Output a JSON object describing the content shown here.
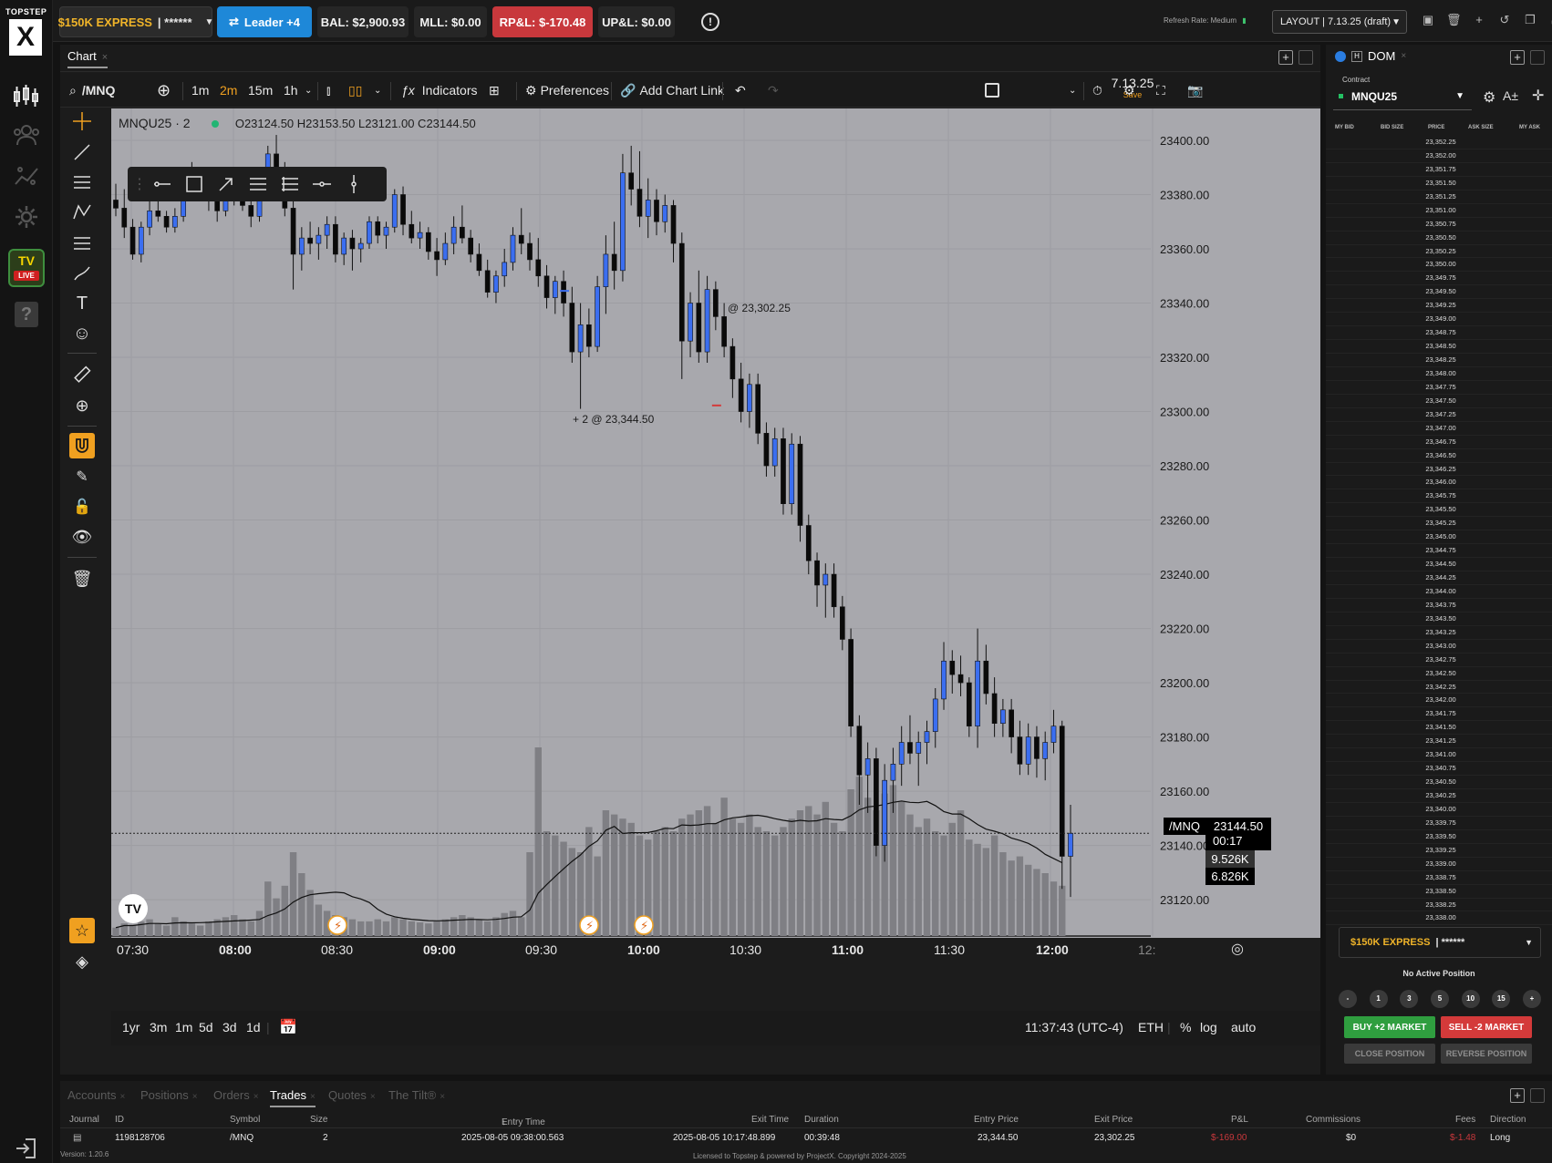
{
  "brand": {
    "line1": "TOPSTEP",
    "line2": "X"
  },
  "rail": {
    "tv_label": "TV",
    "live_label": "LIVE"
  },
  "header": {
    "account_name": "$150K EXPRESS",
    "account_mask": "| ******",
    "leader_label": "Leader +4",
    "bal": "BAL: $2,900.93",
    "mll": "MLL: $0.00",
    "rpl": "RP&L: $-170.48",
    "upl": "UP&L: $0.00",
    "refresh_rate": "Refresh Rate: Medium",
    "layout": "LAYOUT | 7.13.25 (draft)"
  },
  "chart_panel": {
    "tab": "Chart"
  },
  "toolbar": {
    "symbol": "/MNQ",
    "timeframes": [
      "1m",
      "2m",
      "15m",
      "1h"
    ],
    "active_timeframe": "2m",
    "indicators": "Indicators",
    "preferences": "Preferences",
    "add_chart_link": "Add Chart Link",
    "layout_name": "7.13.25",
    "layout_save": "Save"
  },
  "legend": {
    "symbol": "MNQU25 · 2",
    "ohlc": "O23124.50 H23153.50 L23121.00 C23144.50"
  },
  "annotations": {
    "fill_sell": "@ 23,302.25",
    "fill_buy": "+ 2 @ 23,344.50"
  },
  "price_labels": {
    "symbol_tag": "/MNQ",
    "last_price": "23144.50",
    "countdown": "00:17",
    "vol1": "9.526K",
    "vol2": "6.826K"
  },
  "bottom_ranges": [
    "1yr",
    "3m",
    "1m",
    "5d",
    "3d",
    "1d"
  ],
  "status": {
    "clock": "11:37:43 (UTC-4)",
    "session": "ETH",
    "pct": "%",
    "log": "log",
    "auto": "auto"
  },
  "chart_data": {
    "type": "candlestick",
    "symbol": "MNQU25",
    "y_ticks": [
      "23400.00",
      "23380.00",
      "23360.00",
      "23340.00",
      "23320.00",
      "23300.00",
      "23280.00",
      "23260.00",
      "23240.00",
      "23220.00",
      "23200.00",
      "23180.00",
      "23160.00",
      "23140.00",
      "23120.00"
    ],
    "x_ticks": [
      "07:30",
      "08:00",
      "08:30",
      "09:00",
      "09:30",
      "10:00",
      "10:30",
      "11:00",
      "11:30",
      "12:00",
      "12:"
    ],
    "ylim": [
      23116,
      23400
    ],
    "last_price": 23144.5,
    "up_color": "#3b6ef0",
    "down_color": "#0a0a0a",
    "candles": [
      [
        23378,
        23384,
        23372,
        23375
      ],
      [
        23375,
        23382,
        23364,
        23368
      ],
      [
        23368,
        23371,
        23356,
        23358
      ],
      [
        23358,
        23370,
        23355,
        23368
      ],
      [
        23368,
        23378,
        23365,
        23374
      ],
      [
        23374,
        23380,
        23370,
        23372
      ],
      [
        23372,
        23374,
        23366,
        23368
      ],
      [
        23368,
        23375,
        23366,
        23372
      ],
      [
        23372,
        23386,
        23370,
        23384
      ],
      [
        23384,
        23392,
        23382,
        23388
      ],
      [
        23388,
        23390,
        23378,
        23381
      ],
      [
        23381,
        23384,
        23374,
        23378
      ],
      [
        23378,
        23380,
        23370,
        23374
      ],
      [
        23374,
        23382,
        23372,
        23380
      ],
      [
        23380,
        23386,
        23376,
        23378
      ],
      [
        23378,
        23384,
        23374,
        23376
      ],
      [
        23376,
        23378,
        23368,
        23372
      ],
      [
        23372,
        23385,
        23370,
        23382
      ],
      [
        23382,
        23398,
        23378,
        23395
      ],
      [
        23395,
        23402,
        23385,
        23388
      ],
      [
        23388,
        23392,
        23372,
        23375
      ],
      [
        23375,
        23378,
        23345,
        23358
      ],
      [
        23358,
        23368,
        23352,
        23364
      ],
      [
        23364,
        23370,
        23358,
        23362
      ],
      [
        23362,
        23368,
        23356,
        23365
      ],
      [
        23365,
        23372,
        23360,
        23369
      ],
      [
        23369,
        23372,
        23355,
        23358
      ],
      [
        23358,
        23366,
        23354,
        23364
      ],
      [
        23364,
        23367,
        23352,
        23360
      ],
      [
        23360,
        23364,
        23355,
        23362
      ],
      [
        23362,
        23372,
        23360,
        23370
      ],
      [
        23370,
        23372,
        23362,
        23365
      ],
      [
        23365,
        23370,
        23360,
        23368
      ],
      [
        23368,
        23382,
        23366,
        23380
      ],
      [
        23380,
        23383,
        23365,
        23369
      ],
      [
        23369,
        23374,
        23362,
        23364
      ],
      [
        23364,
        23370,
        23360,
        23366
      ],
      [
        23366,
        23368,
        23356,
        23359
      ],
      [
        23359,
        23364,
        23350,
        23356
      ],
      [
        23356,
        23366,
        23354,
        23362
      ],
      [
        23362,
        23372,
        23358,
        23368
      ],
      [
        23368,
        23376,
        23362,
        23364
      ],
      [
        23364,
        23367,
        23355,
        23358
      ],
      [
        23358,
        23362,
        23350,
        23352
      ],
      [
        23352,
        23356,
        23342,
        23344
      ],
      [
        23344,
        23352,
        23340,
        23350
      ],
      [
        23350,
        23360,
        23346,
        23355
      ],
      [
        23355,
        23368,
        23352,
        23365
      ],
      [
        23365,
        23375,
        23358,
        23362
      ],
      [
        23362,
        23366,
        23352,
        23356
      ],
      [
        23356,
        23364,
        23346,
        23350
      ],
      [
        23350,
        23354,
        23338,
        23342
      ],
      [
        23342,
        23350,
        23336,
        23348
      ],
      [
        23348,
        23352,
        23335,
        23340
      ],
      [
        23340,
        23346,
        23318,
        23322
      ],
      [
        23322,
        23340,
        23301,
        23332
      ],
      [
        23332,
        23338,
        23320,
        23324
      ],
      [
        23324,
        23350,
        23322,
        23346
      ],
      [
        23346,
        23365,
        23336,
        23358
      ],
      [
        23358,
        23370,
        23345,
        23352
      ],
      [
        23352,
        23395,
        23348,
        23388
      ],
      [
        23388,
        23398,
        23376,
        23382
      ],
      [
        23382,
        23396,
        23368,
        23372
      ],
      [
        23372,
        23386,
        23364,
        23378
      ],
      [
        23378,
        23382,
        23365,
        23370
      ],
      [
        23370,
        23380,
        23366,
        23376
      ],
      [
        23376,
        23378,
        23355,
        23362
      ],
      [
        23362,
        23366,
        23312,
        23326
      ],
      [
        23326,
        23344,
        23320,
        23340
      ],
      [
        23340,
        23352,
        23318,
        23322
      ],
      [
        23322,
        23350,
        23318,
        23345
      ],
      [
        23345,
        23348,
        23330,
        23335
      ],
      [
        23335,
        23340,
        23320,
        23324
      ],
      [
        23324,
        23327,
        23305,
        23312
      ],
      [
        23312,
        23318,
        23296,
        23300
      ],
      [
        23300,
        23314,
        23294,
        23310
      ],
      [
        23310,
        23314,
        23288,
        23292
      ],
      [
        23292,
        23296,
        23276,
        23280
      ],
      [
        23280,
        23294,
        23276,
        23290
      ],
      [
        23290,
        23294,
        23262,
        23266
      ],
      [
        23266,
        23292,
        23262,
        23288
      ],
      [
        23288,
        23291,
        23252,
        23258
      ],
      [
        23258,
        23262,
        23240,
        23245
      ],
      [
        23245,
        23248,
        23228,
        23236
      ],
      [
        23236,
        23244,
        23224,
        23240
      ],
      [
        23240,
        23244,
        23224,
        23228
      ],
      [
        23228,
        23232,
        23212,
        23216
      ],
      [
        23216,
        23220,
        23180,
        23184
      ],
      [
        23184,
        23188,
        23155,
        23166
      ],
      [
        23166,
        23178,
        23152,
        23172
      ],
      [
        23172,
        23176,
        23136,
        23140
      ],
      [
        23140,
        23170,
        23134,
        23164
      ],
      [
        23164,
        23176,
        23152,
        23170
      ],
      [
        23170,
        23184,
        23162,
        23178
      ],
      [
        23178,
        23188,
        23170,
        23174
      ],
      [
        23174,
        23182,
        23162,
        23178
      ],
      [
        23178,
        23186,
        23170,
        23182
      ],
      [
        23182,
        23198,
        23176,
        23194
      ],
      [
        23194,
        23215,
        23190,
        23208
      ],
      [
        23208,
        23212,
        23196,
        23203
      ],
      [
        23203,
        23210,
        23195,
        23200
      ],
      [
        23200,
        23202,
        23180,
        23184
      ],
      [
        23184,
        23220,
        23176,
        23208
      ],
      [
        23208,
        23214,
        23192,
        23196
      ],
      [
        23196,
        23202,
        23180,
        23185
      ],
      [
        23185,
        23194,
        23180,
        23190
      ],
      [
        23190,
        23194,
        23174,
        23180
      ],
      [
        23180,
        23186,
        23166,
        23170
      ],
      [
        23170,
        23185,
        23166,
        23180
      ],
      [
        23180,
        23184,
        23165,
        23172
      ],
      [
        23172,
        23182,
        23164,
        23178
      ],
      [
        23178,
        23190,
        23174,
        23184
      ],
      [
        23184,
        23186,
        23124,
        23136
      ],
      [
        23136,
        23155,
        23121,
        23144.5
      ]
    ],
    "volume_scale_max": 10000,
    "volumes": [
      400,
      600,
      500,
      700,
      800,
      600,
      500,
      900,
      700,
      600,
      500,
      700,
      800,
      900,
      1000,
      800,
      700,
      1200,
      2600,
      1800,
      2400,
      4000,
      3000,
      2200,
      1500,
      1200,
      1000,
      900,
      800,
      700,
      700,
      800,
      700,
      900,
      800,
      700,
      650,
      600,
      700,
      800,
      900,
      1000,
      900,
      800,
      700,
      900,
      1100,
      1200,
      900,
      4000,
      9000,
      5000,
      4800,
      4500,
      4200,
      4000,
      5200,
      3800,
      6000,
      5800,
      5600,
      5400,
      4800,
      4600,
      5000,
      5200,
      5000,
      5600,
      5800,
      6000,
      6200,
      5400,
      6600,
      5600,
      5400,
      5800,
      5200,
      5000,
      4800,
      5200,
      5600,
      6000,
      6200,
      5800,
      6400,
      5400,
      5000,
      7000,
      7600,
      6600,
      6000,
      6800,
      7200,
      6400,
      5800,
      5200,
      5600,
      5000,
      4800,
      5400,
      6000,
      4600,
      4400,
      4200,
      4800,
      4000,
      3600,
      3800,
      3400,
      3200,
      3000,
      2600,
      2400
    ]
  },
  "dom": {
    "tab": "DOM",
    "contract_label": "Contract",
    "contract": "MNQU25",
    "headers": [
      "MY BID",
      "BID SIZE",
      "PRICE",
      "ASK SIZE",
      "MY ASK"
    ],
    "prices": [
      "23,352.25",
      "23,352.00",
      "23,351.75",
      "23,351.50",
      "23,351.25",
      "23,351.00",
      "23,350.75",
      "23,350.50",
      "23,350.25",
      "23,350.00",
      "23,349.75",
      "23,349.50",
      "23,349.25",
      "23,349.00",
      "23,348.75",
      "23,348.50",
      "23,348.25",
      "23,348.00",
      "23,347.75",
      "23,347.50",
      "23,347.25",
      "23,347.00",
      "23,346.75",
      "23,346.50",
      "23,346.25",
      "23,346.00",
      "23,345.75",
      "23,345.50",
      "23,345.25",
      "23,345.00",
      "23,344.75",
      "23,344.50",
      "23,344.25",
      "23,344.00",
      "23,343.75",
      "23,343.50",
      "23,343.25",
      "23,343.00",
      "23,342.75",
      "23,342.50",
      "23,342.25",
      "23,342.00",
      "23,341.75",
      "23,341.50",
      "23,341.25",
      "23,341.00",
      "23,340.75",
      "23,340.50",
      "23,340.25",
      "23,340.00",
      "23,339.75",
      "23,339.50",
      "23,339.25",
      "23,339.00",
      "23,338.75",
      "23,338.50",
      "23,338.25",
      "23,338.00"
    ],
    "account_name": "$150K EXPRESS",
    "account_mask": "| ******",
    "no_position": "No Active Position",
    "quantities": [
      "-",
      "1",
      "3",
      "5",
      "10",
      "15",
      "+"
    ],
    "buy_market": "BUY +2 MARKET",
    "sell_market": "SELL -2 MARKET",
    "close_position": "CLOSE POSITION",
    "reverse_position": "REVERSE POSITION"
  },
  "bottom_tabs": [
    "Accounts",
    "Positions",
    "Orders",
    "Trades",
    "Quotes",
    "The Tilt®"
  ],
  "trades": {
    "headers": [
      "Journal",
      "ID",
      "Symbol",
      "Size",
      "Entry Time",
      "Exit Time",
      "Duration",
      "Entry Price",
      "Exit Price",
      "P&L",
      "Commissions",
      "Fees",
      "Direction"
    ],
    "rows": [
      {
        "id": "1198128706",
        "symbol": "/MNQ",
        "size": "2",
        "entry_time": "2025-08-05 09:38:00.563",
        "exit_time": "2025-08-05 10:17:48.899",
        "duration": "00:39:48",
        "entry_price": "23,344.50",
        "exit_price": "23,302.25",
        "pnl": "$-169.00",
        "commissions": "$0",
        "fees": "$-1.48",
        "direction": "Long"
      }
    ]
  },
  "footer": {
    "version": "Version: 1.20.6",
    "license": "Licensed to Topstep & powered by ProjectX. Copyright 2024-2025"
  },
  "colors": {
    "accent": "#f0a020",
    "buy": "#2f9e3f",
    "sell": "#d43a3a",
    "leader": "#1e88d8",
    "plot_bg": "#a8a8ad"
  }
}
